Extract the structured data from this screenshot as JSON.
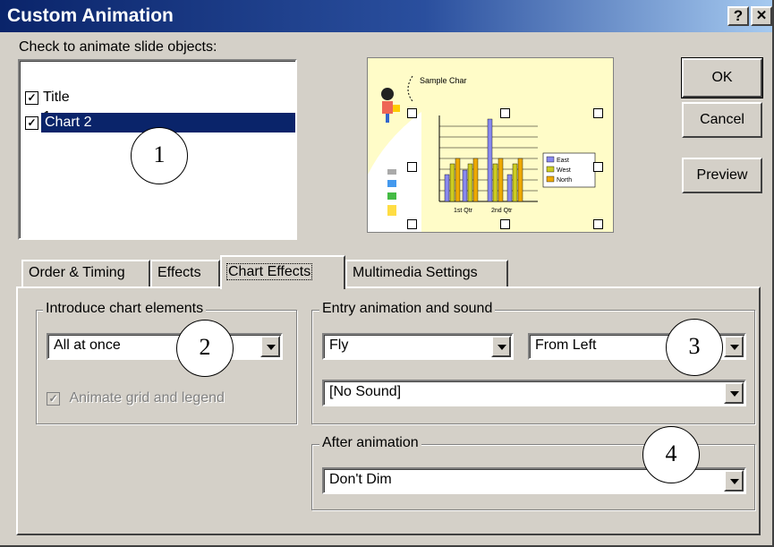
{
  "window": {
    "title": "Custom Animation",
    "help_glyph": "?",
    "close_glyph": "✕"
  },
  "objects_list": {
    "label": "Check to animate slide objects:",
    "items": [
      {
        "label": "Title 1",
        "checked": true,
        "selected": false
      },
      {
        "label": "Chart 2",
        "checked": true,
        "selected": true
      }
    ]
  },
  "preview_thumb": {
    "title": "Sample Char",
    "legend": [
      "East",
      "West",
      "North"
    ],
    "x_labels": [
      "1st Qtr",
      "2nd Qtr"
    ],
    "colors": {
      "east": "#8888ee",
      "west": "#cccc22",
      "north": "#eeaa00"
    }
  },
  "buttons": {
    "ok": "OK",
    "cancel": "Cancel",
    "preview": "Preview"
  },
  "tabs": [
    {
      "label": "Order & Timing",
      "active": false
    },
    {
      "label": "Effects",
      "active": false
    },
    {
      "label": "Chart Effects",
      "active": true
    },
    {
      "label": "Multimedia Settings",
      "active": false
    }
  ],
  "introduce": {
    "group_label": "Introduce chart elements",
    "value": "All at once",
    "animate_grid_label": "Animate grid and legend",
    "animate_grid_checked": true,
    "animate_grid_disabled": true
  },
  "entry": {
    "group_label": "Entry animation and sound",
    "effect": "Fly",
    "direction": "From Left",
    "sound": "[No Sound]"
  },
  "after": {
    "group_label": "After animation",
    "value": "Don't Dim"
  },
  "callouts": [
    "1",
    "2",
    "3",
    "4"
  ]
}
